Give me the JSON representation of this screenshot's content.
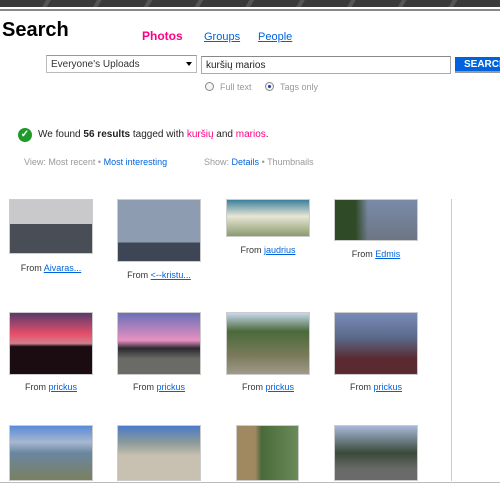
{
  "header": {
    "title": "Search",
    "tabs": [
      {
        "label": "Photos",
        "active": true
      },
      {
        "label": "Groups"
      },
      {
        "label": "People"
      }
    ]
  },
  "search": {
    "scope": "Everyone's Uploads",
    "query": "kuršių marios",
    "button": "SEARCH",
    "options": [
      {
        "label": "Full text",
        "selected": false
      },
      {
        "label": "Tags only",
        "selected": true
      }
    ]
  },
  "results": {
    "prefix": "We found",
    "count": "56 results",
    "middle": "tagged with",
    "tag1": "kuršių",
    "and": "and",
    "tag2": "marios",
    "end": "."
  },
  "view": {
    "label": "View:",
    "recent": "Most recent",
    "sep": "•",
    "interesting": "Most interesting"
  },
  "show": {
    "label": "Show:",
    "details": "Details",
    "sep": "•",
    "thumbnails": "Thumbnails"
  },
  "photos": [
    {
      "from": "From",
      "user": "Aivaras..."
    },
    {
      "from": "From",
      "user": "<--kristu..."
    },
    {
      "from": "From",
      "user": "jaudrius"
    },
    {
      "from": "From",
      "user": "Edmis"
    },
    {
      "from": "From",
      "user": "prickus"
    },
    {
      "from": "From",
      "user": "prickus"
    },
    {
      "from": "From",
      "user": "prickus"
    },
    {
      "from": "From",
      "user": "prickus"
    },
    {
      "from": "",
      "user": ""
    },
    {
      "from": "",
      "user": ""
    },
    {
      "from": "",
      "user": ""
    },
    {
      "from": "",
      "user": ""
    }
  ],
  "colors": {
    "accent": "#ff0084",
    "link": "#0063dc"
  }
}
